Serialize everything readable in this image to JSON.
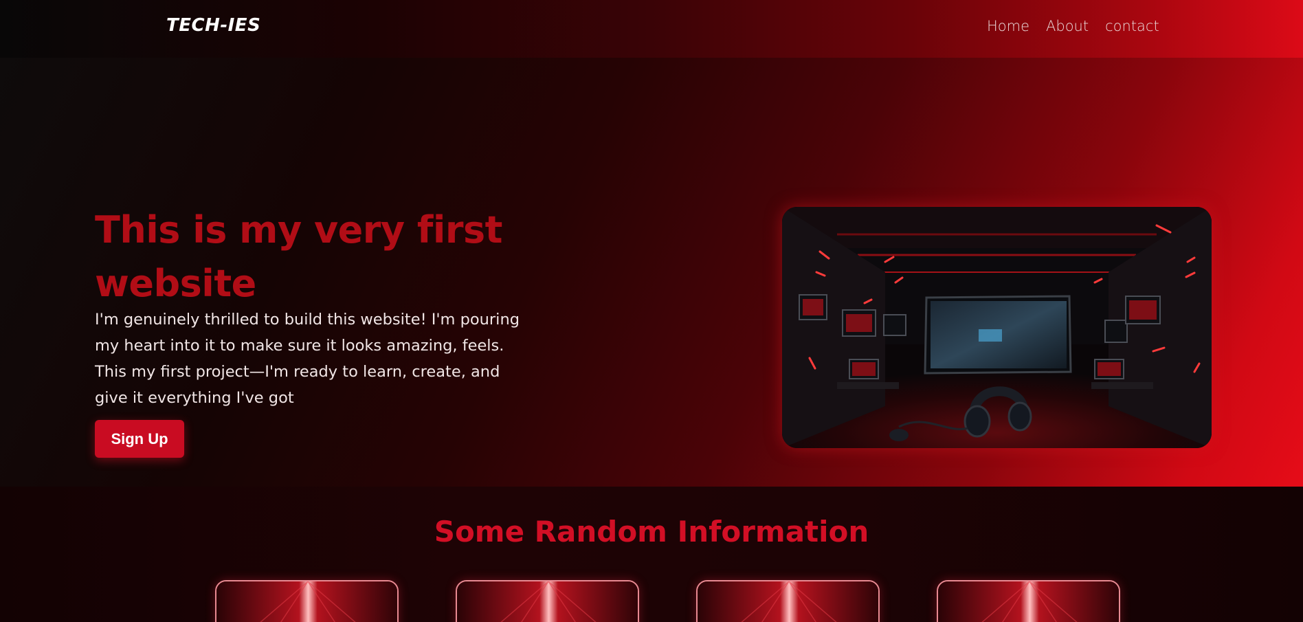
{
  "navbar": {
    "logo": "TECH-IES",
    "links": [
      {
        "label": "Home"
      },
      {
        "label": "About"
      },
      {
        "label": "contact"
      }
    ]
  },
  "hero": {
    "title": "This is my very first website",
    "description": "I'm genuinely thrilled to build this website! I'm pouring my heart into it to make sure it looks amazing, feels. This my first project—I'm ready to learn, create, and give it everything I've got",
    "signup_label": "Sign Up",
    "image_icon": "gaming-room-image"
  },
  "info": {
    "title": "Some Random Information",
    "cards": [
      {
        "image_icon": "red-light-card-image"
      },
      {
        "image_icon": "red-light-card-image"
      },
      {
        "image_icon": "red-light-card-image"
      },
      {
        "image_icon": "red-light-card-image"
      }
    ]
  },
  "colors": {
    "accent": "#c90c22",
    "title": "#b10d16",
    "section_title": "#d20f25"
  }
}
